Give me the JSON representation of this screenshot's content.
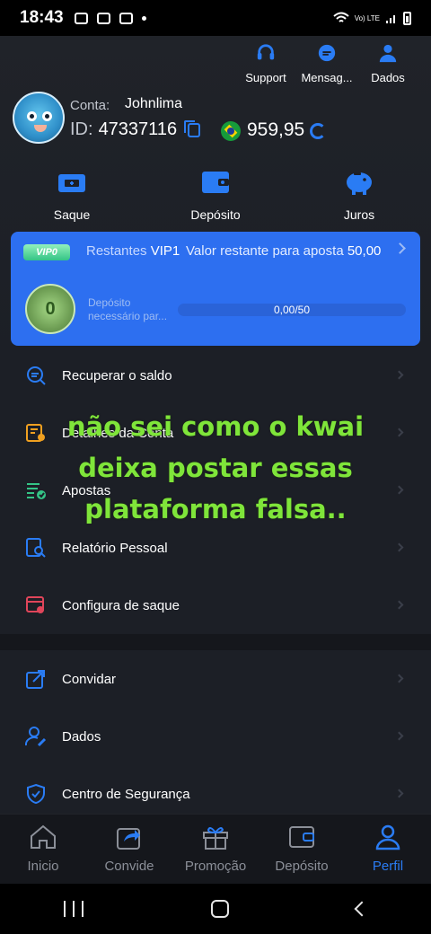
{
  "status_bar": {
    "time": "18:43",
    "network": "Vo) LTE"
  },
  "header": {
    "icons": [
      {
        "label": "Support",
        "icon": "headset-icon"
      },
      {
        "label": "Mensag...",
        "icon": "chat-icon"
      },
      {
        "label": "Dados",
        "icon": "user-icon"
      }
    ]
  },
  "profile": {
    "conta_label": "Conta:",
    "username": "Johnlima",
    "id_label": "ID:",
    "id_value": "47337116",
    "balance": "959,95"
  },
  "actions": [
    {
      "label": "Saque",
      "icon": "wallet-out-icon"
    },
    {
      "label": "Depósito",
      "icon": "wallet-icon"
    },
    {
      "label": "Juros",
      "icon": "piggy-bank-icon"
    }
  ],
  "vip": {
    "badge": "VIP0",
    "restantes_label": "Restantes",
    "level": "VIP1",
    "remaining_text": "Valor restante para aposta",
    "remaining_value": "50,00",
    "medal_value": "0",
    "deposit_label": "Depósito necessário par...",
    "progress_text": "0,00/50",
    "progress_fraction": 0.0
  },
  "menu": {
    "group1": [
      {
        "label": "Recuperar o saldo",
        "icon": "recover-balance-icon",
        "color": "#2a7cf4"
      },
      {
        "label": "Detalhes da Conta",
        "icon": "account-details-icon",
        "color": "#f0a020"
      },
      {
        "label": "Apostas",
        "icon": "bets-icon",
        "color": "#34c486"
      },
      {
        "label": "Relatório Pessoal",
        "icon": "report-icon",
        "color": "#2a7cf4"
      },
      {
        "label": "Configura de saque",
        "icon": "withdraw-settings-icon",
        "color": "#e0455a"
      }
    ],
    "group2": [
      {
        "label": "Convidar",
        "icon": "share-icon",
        "color": "#2a7cf4"
      },
      {
        "label": "Dados",
        "icon": "user-edit-icon",
        "color": "#2a7cf4"
      },
      {
        "label": "Centro de Segurança",
        "icon": "shield-icon",
        "color": "#2a7cf4"
      }
    ]
  },
  "overlay_text": [
    "não sei como o kwai",
    "deixa postar essas",
    "plataforma falsa.."
  ],
  "tabs": [
    {
      "label": "Inicio",
      "icon": "home-icon",
      "active": false
    },
    {
      "label": "Convide",
      "icon": "share-icon",
      "active": false
    },
    {
      "label": "Promoção",
      "icon": "gift-icon",
      "active": false
    },
    {
      "label": "Depósito",
      "icon": "wallet-icon",
      "active": false
    },
    {
      "label": "Perfil",
      "icon": "profile-icon",
      "active": true
    }
  ],
  "colors": {
    "accent": "#2a7cf4",
    "vip_card": "#2d6ff0",
    "overlay_text": "#7fe53a"
  }
}
